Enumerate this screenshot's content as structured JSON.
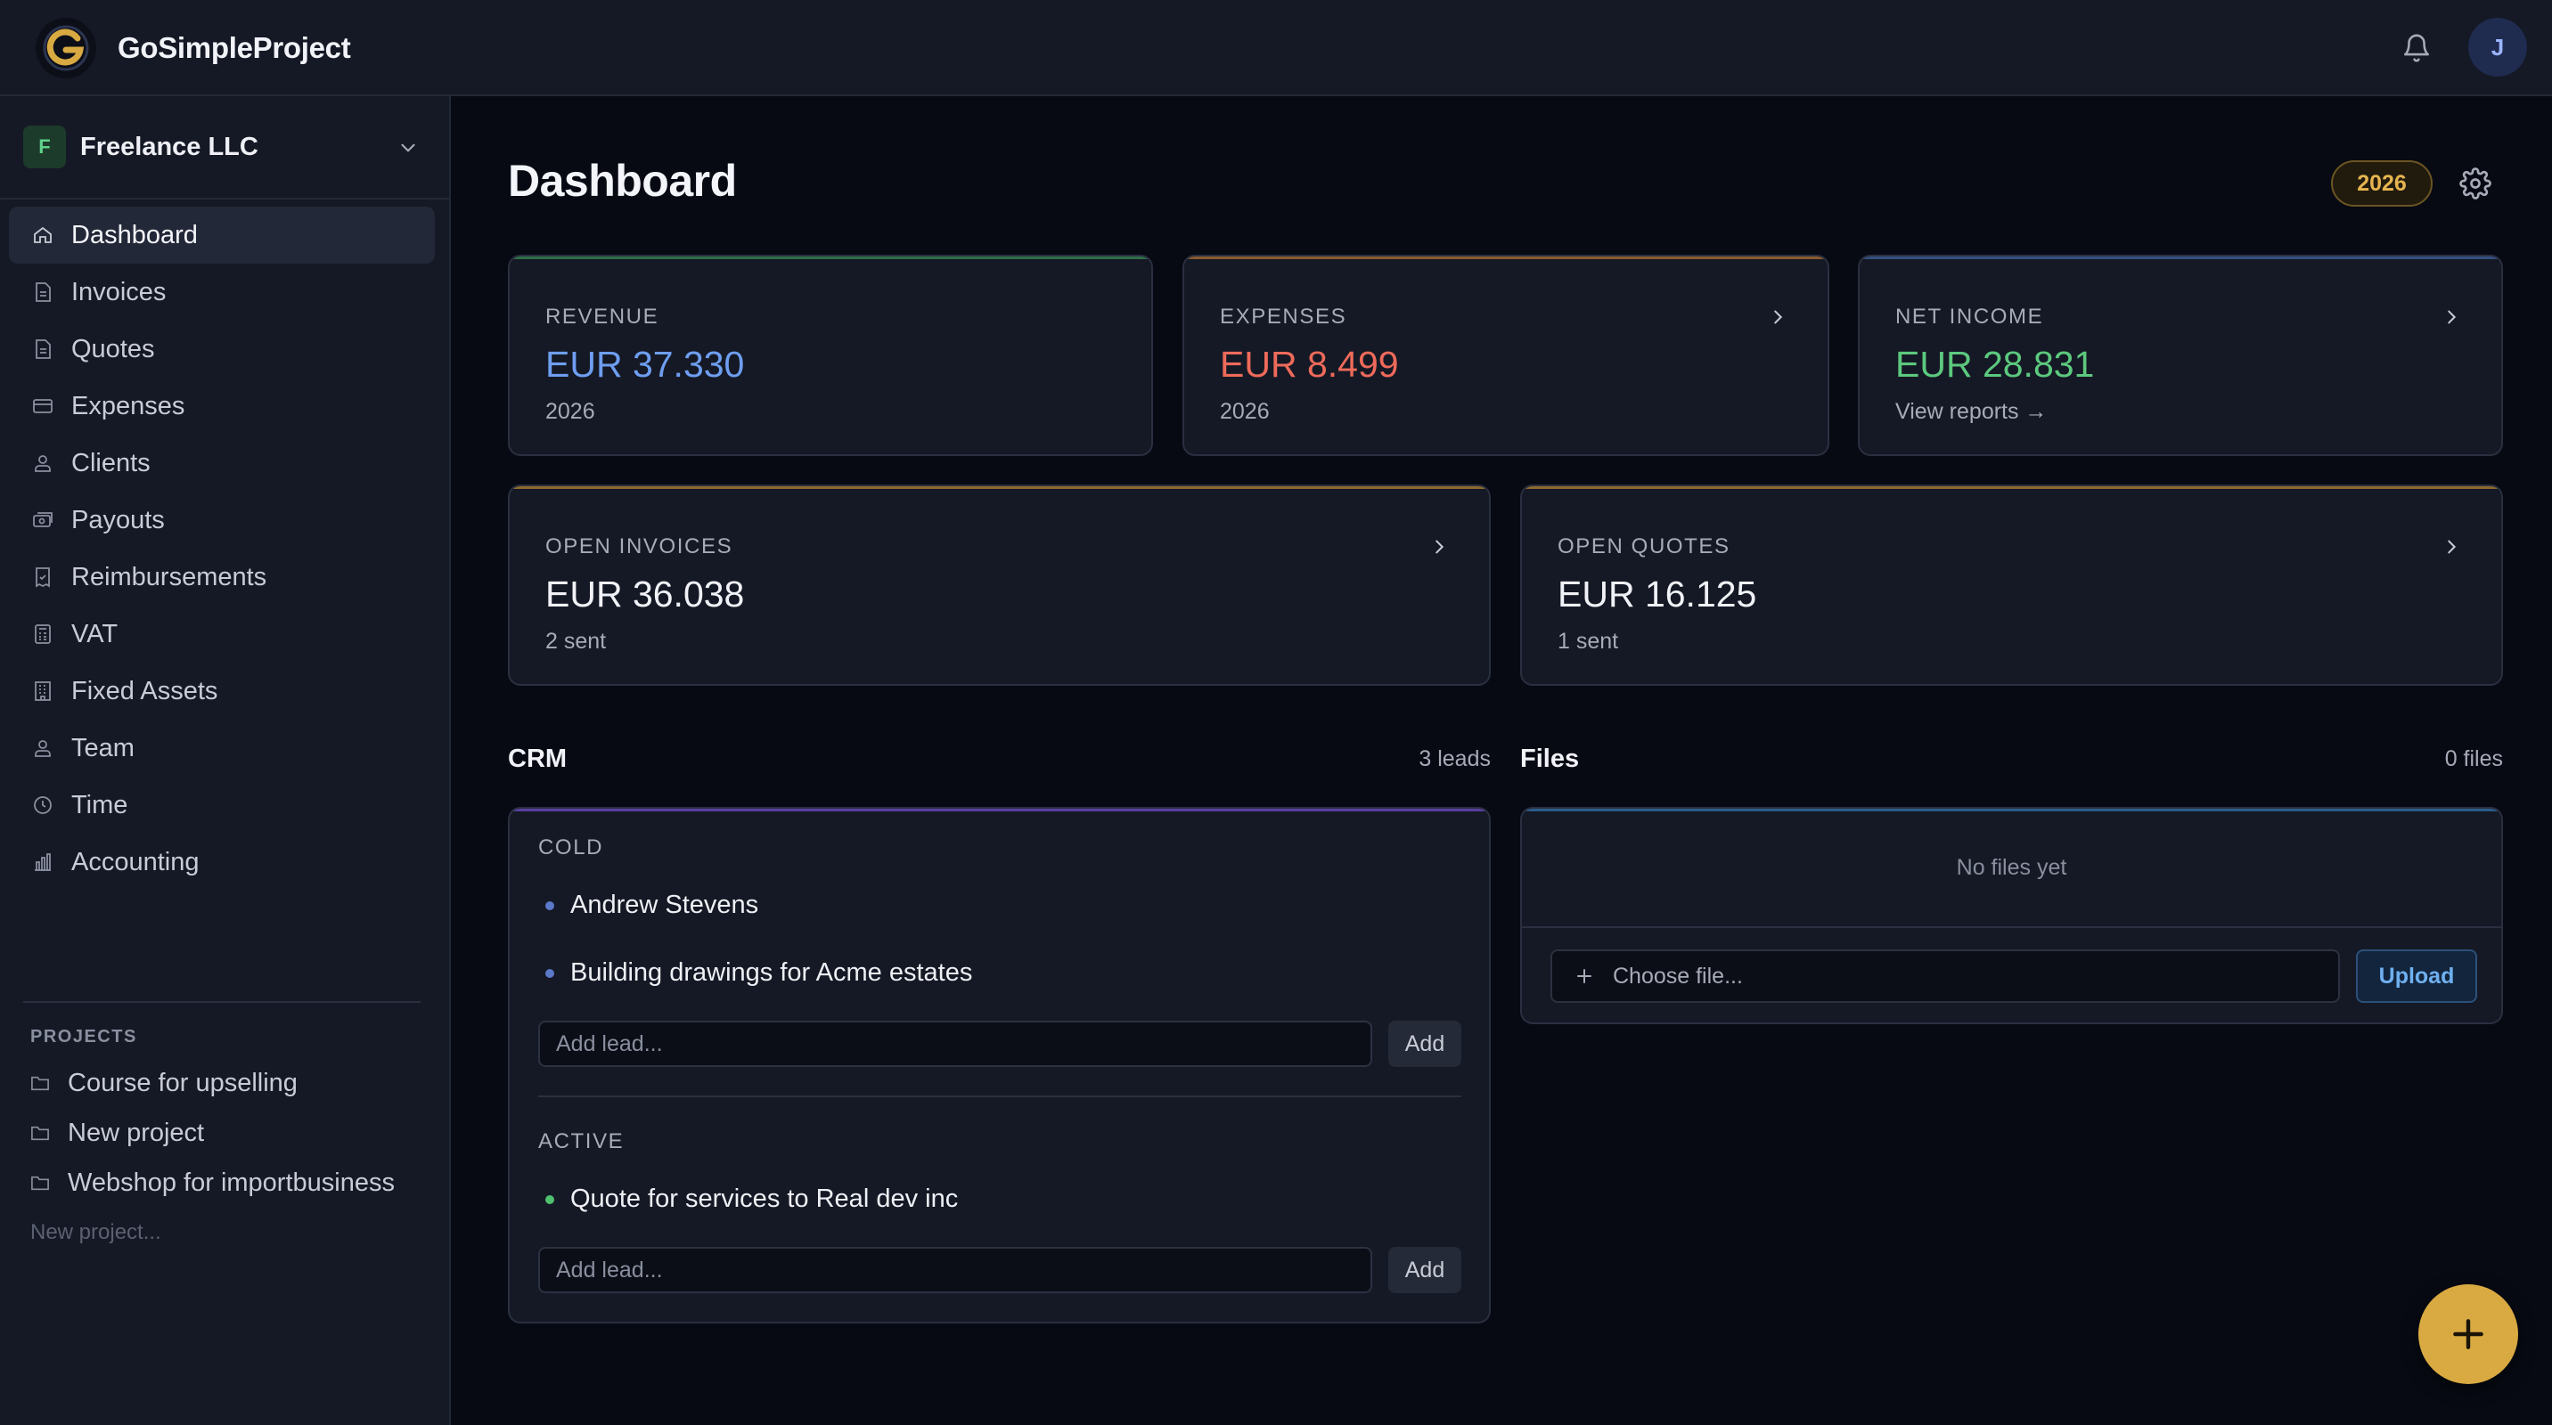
{
  "app": {
    "name": "GoSimpleProject",
    "user_initial": "J"
  },
  "org": {
    "badge": "F",
    "name": "Freelance LLC"
  },
  "nav": [
    {
      "label": "Dashboard",
      "icon": "home-icon",
      "active": true
    },
    {
      "label": "Invoices",
      "icon": "document-icon"
    },
    {
      "label": "Quotes",
      "icon": "document-icon"
    },
    {
      "label": "Expenses",
      "icon": "card-icon"
    },
    {
      "label": "Clients",
      "icon": "users-icon"
    },
    {
      "label": "Payouts",
      "icon": "cash-icon"
    },
    {
      "label": "Reimbursements",
      "icon": "receipt-icon"
    },
    {
      "label": "VAT",
      "icon": "calculator-icon"
    },
    {
      "label": "Fixed Assets",
      "icon": "building-icon"
    },
    {
      "label": "Team",
      "icon": "users-icon"
    },
    {
      "label": "Time",
      "icon": "clock-icon"
    },
    {
      "label": "Accounting",
      "icon": "bar-chart-icon"
    }
  ],
  "projects": {
    "heading": "PROJECTS",
    "items": [
      "Course for upselling",
      "New project",
      "Webshop for importbusiness"
    ],
    "new_placeholder": "New project..."
  },
  "header": {
    "title": "Dashboard",
    "year": "2026"
  },
  "summary": {
    "revenue": {
      "label": "REVENUE",
      "value": "EUR 37.330",
      "sub": "2026",
      "color": "#6e9ef0",
      "accent": "#2f6e48"
    },
    "expenses": {
      "label": "EXPENSES",
      "value": "EUR 8.499",
      "sub": "2026",
      "color": "#ef6a5a",
      "accent": "#8a5a2e"
    },
    "net_income": {
      "label": "NET INCOME",
      "value": "EUR 28.831",
      "sub": "View reports →",
      "color": "#5cc97e",
      "accent": "#34507f"
    },
    "open_invoices": {
      "label": "OPEN INVOICES",
      "value": "EUR 36.038",
      "sub": "2 sent",
      "accent": "#8a6a2e"
    },
    "open_quotes": {
      "label": "OPEN QUOTES",
      "value": "EUR 16.125",
      "sub": "1 sent",
      "accent": "#8a6a2e"
    }
  },
  "crm": {
    "title": "CRM",
    "count": "3 leads",
    "groups": [
      {
        "name": "COLD",
        "dot_color": "#5b78c9",
        "leads": [
          "Andrew Stevens",
          "Building drawings for Acme estates"
        ]
      },
      {
        "name": "ACTIVE",
        "dot_color": "#4fc06f",
        "leads": [
          "Quote for services to Real dev inc"
        ]
      }
    ],
    "add_placeholder": "Add lead...",
    "add_label": "Add"
  },
  "files": {
    "title": "Files",
    "count": "0 files",
    "empty": "No files yet",
    "choose_label": "Choose file...",
    "upload_label": "Upload"
  }
}
